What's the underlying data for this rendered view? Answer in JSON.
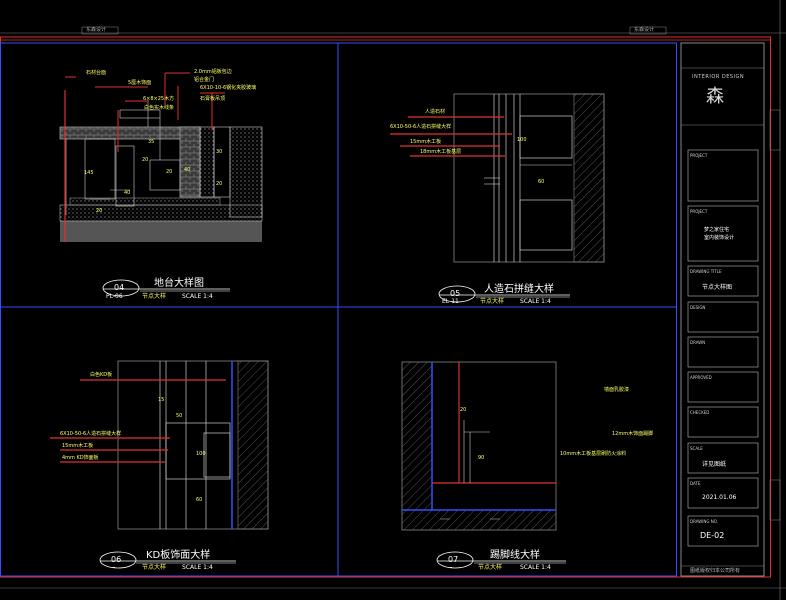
{
  "header": {
    "stamp_left": "东森设计",
    "stamp_right": "东森设计"
  },
  "details": [
    {
      "id": "04",
      "ref": "PL-06",
      "title": "地台大样图",
      "subtitle": "节点大样",
      "scale": "SCALE 1:4",
      "dims": [
        "145",
        "20",
        "40",
        "20",
        "35",
        "20",
        "40",
        "30",
        "20"
      ],
      "callouts": [
        "石材台面",
        "5厘木饰面",
        "2.0mm铝板包边",
        "铝合金门",
        "6×8×25木方",
        "6X10-10-6钢化夹胶玻璃",
        "白色实木线条",
        "石膏板吊顶"
      ]
    },
    {
      "id": "05",
      "ref": "EL-11",
      "title": "人造石拼缝大样",
      "subtitle": "节点大样",
      "scale": "SCALE 1:4",
      "dims": [
        "100",
        "60"
      ],
      "callouts": [
        "人造石材",
        "6X10-50-6人造石拼缝大样",
        "15mm木工板",
        "18mm木工板基层"
      ]
    },
    {
      "id": "06",
      "ref": "-",
      "title": "KD板饰面大样",
      "subtitle": "节点大样",
      "scale": "SCALE 1:4",
      "dims": [
        "15",
        "50",
        "100",
        "60"
      ],
      "callouts": [
        "白色KD板",
        "6X10-50-6人造石拼缝大样",
        "15mm木工板",
        "4mm KD饰面板"
      ]
    },
    {
      "id": "07",
      "ref": "-",
      "title": "踢脚线大样",
      "subtitle": "节点大样",
      "scale": "SCALE 1:4",
      "dims": [
        "20",
        "90"
      ],
      "callouts": [
        "墙面乳胶漆",
        "12mm木饰面踢脚",
        "10mm木工板基层刷防火涂料"
      ]
    }
  ],
  "title_block": {
    "design_label": "INTERIOR DESIGN",
    "logo_char": "森",
    "rows": [
      {
        "label": "PROJECT",
        "value": ""
      },
      {
        "label": "PROJECT",
        "value": "梦之家住宅\n室内装饰设计"
      },
      {
        "label": "DRAWING TITLE",
        "value": "节点大样图"
      },
      {
        "label": "DESIGN",
        "value": ""
      },
      {
        "label": "DRAWN",
        "value": ""
      },
      {
        "label": "APPROVED",
        "value": ""
      },
      {
        "label": "CHECKED",
        "value": ""
      },
      {
        "label": "SCALE",
        "value": "详见图纸"
      },
      {
        "label": "DATE",
        "value": "2021.01.06"
      },
      {
        "label": "DRAWING NO.",
        "value": "DE-02"
      }
    ]
  },
  "footer": {
    "note": "图纸版权归本公司所有"
  }
}
